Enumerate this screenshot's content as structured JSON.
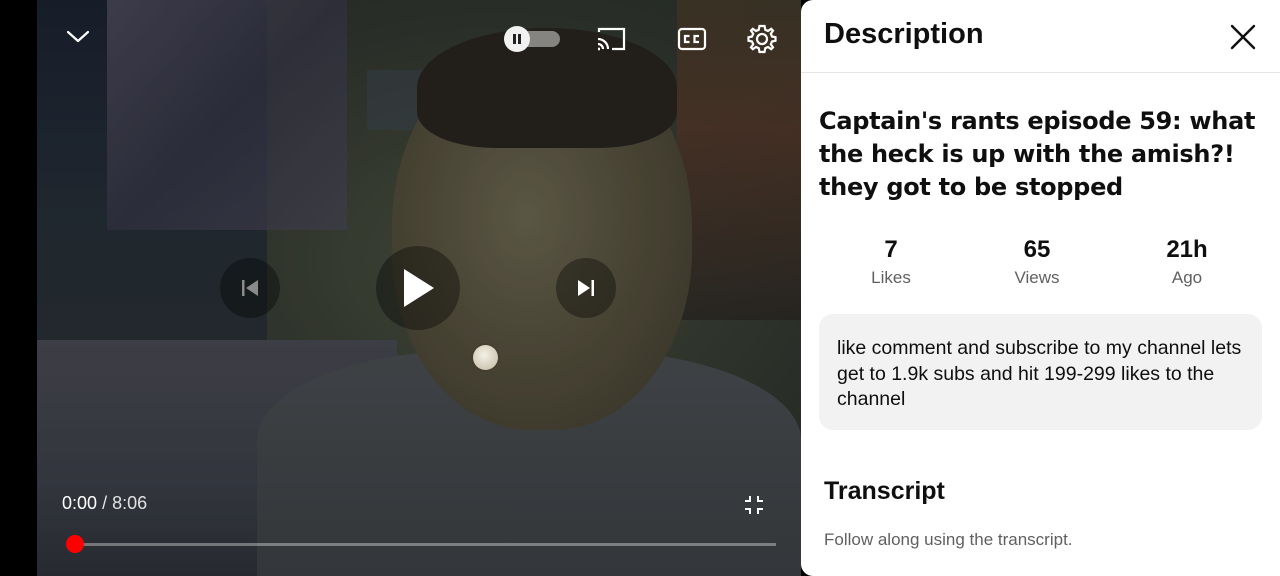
{
  "player": {
    "current_time": "0:00",
    "separator": "/",
    "duration": "8:06",
    "progress_fraction": 0.0,
    "accent_color": "#ff0000",
    "autoplay_on": false,
    "icons": {
      "collapse": "chevron-down-icon",
      "autoplay": "pause-icon",
      "cast": "cast-icon",
      "captions": "cc-icon",
      "settings": "gear-icon",
      "previous": "skip-previous-icon",
      "play": "play-icon",
      "next": "skip-next-icon",
      "fullscreen_exit": "fullscreen-exit-icon"
    }
  },
  "panel": {
    "header_title": "Description",
    "close_icon": "close-icon",
    "video_title": "Captain's rants episode 59: what the heck is up with the amish?! they got to be stopped",
    "stats": [
      {
        "value": "7",
        "label": "Likes"
      },
      {
        "value": "65",
        "label": "Views"
      },
      {
        "value": "21h",
        "label": "Ago"
      }
    ],
    "description": "like comment and subscribe to my channel lets get to 1.9k subs and hit 199-299 likes to the channel",
    "transcript": {
      "heading": "Transcript",
      "subtitle": "Follow along using the transcript."
    }
  }
}
